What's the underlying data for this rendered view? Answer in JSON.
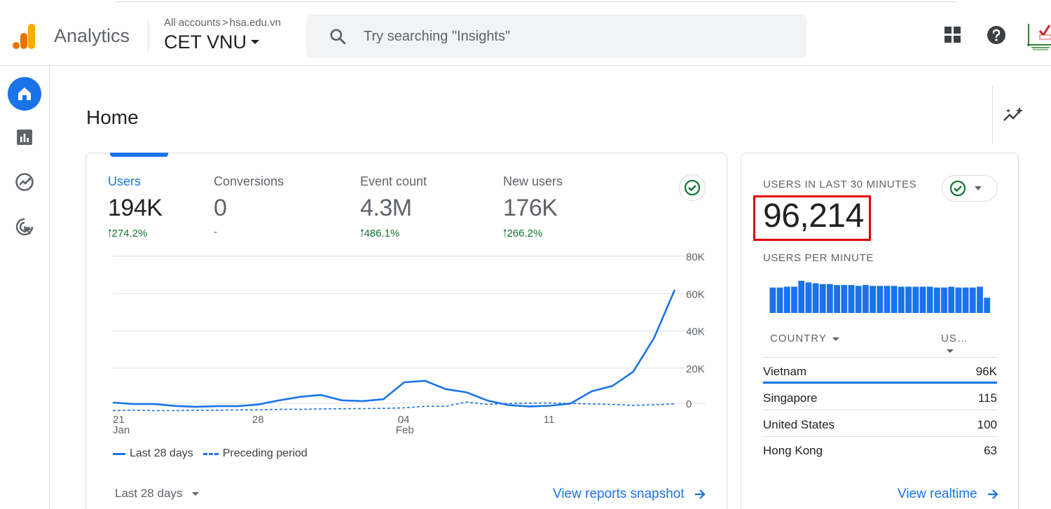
{
  "app": {
    "name": "Analytics"
  },
  "breadcrumb": {
    "account": "All accounts",
    "sub": "hsa.edu.vn"
  },
  "property": {
    "name": "CET VNU"
  },
  "search": {
    "placeholder": "Try searching \"Insights\""
  },
  "page": {
    "title": "Home"
  },
  "metrics": [
    {
      "label": "Users",
      "value": "194K",
      "change": "274.2%"
    },
    {
      "label": "Conversions",
      "value": "0",
      "change": "-"
    },
    {
      "label": "Event count",
      "value": "4.3M",
      "change": "486.1%"
    },
    {
      "label": "New users",
      "value": "176K",
      "change": "266.2%"
    }
  ],
  "chart_data": {
    "type": "line",
    "x_tick_labels": [
      {
        "day": "21",
        "month": "Jan"
      },
      {
        "day": "28",
        "month": ""
      },
      {
        "day": "04",
        "month": "Feb"
      },
      {
        "day": "11",
        "month": ""
      }
    ],
    "y_tick_labels": [
      "80K",
      "60K",
      "40K",
      "20K",
      "0"
    ],
    "ylim": [
      0,
      80000
    ],
    "x": [
      "Jan 21",
      "Jan 22",
      "Jan 23",
      "Jan 24",
      "Jan 25",
      "Jan 26",
      "Jan 27",
      "Jan 28",
      "Jan 29",
      "Jan 30",
      "Jan 31",
      "Feb 1",
      "Feb 2",
      "Feb 3",
      "Feb 4",
      "Feb 5",
      "Feb 6",
      "Feb 7",
      "Feb 8",
      "Feb 9",
      "Feb 10",
      "Feb 11",
      "Feb 12",
      "Feb 13",
      "Feb 14",
      "Feb 15",
      "Feb 16",
      "Feb 17"
    ],
    "series": [
      {
        "name": "Last 28 days",
        "style": "solid",
        "values": [
          1500,
          700,
          700,
          -300,
          -800,
          -400,
          -400,
          500,
          2700,
          4600,
          5600,
          2700,
          2300,
          3300,
          12400,
          13200,
          8700,
          7000,
          2600,
          200,
          -600,
          -200,
          1000,
          7500,
          10400,
          18000,
          36000,
          62000
        ]
      },
      {
        "name": "Preceding period",
        "style": "dashed",
        "values": [
          -2800,
          -2500,
          -2800,
          -2800,
          -2600,
          -2600,
          -2400,
          -2400,
          -2100,
          -2100,
          -1900,
          -1800,
          -1700,
          -1600,
          -1300,
          -500,
          -500,
          1800,
          500,
          1000,
          1200,
          1300,
          1000,
          800,
          500,
          0,
          300,
          800
        ]
      }
    ],
    "grid": true
  },
  "legend": {
    "current": "Last 28 days",
    "previous": "Preceding period"
  },
  "range": {
    "label": "Last 28 days"
  },
  "links": {
    "snapshot": "View reports snapshot",
    "realtime": "View realtime"
  },
  "realtime": {
    "title": "USERS IN LAST 30 MINUTES",
    "value": "96,214",
    "subtitle": "USERS PER MINUTE",
    "per_minute": [
      30,
      30,
      31,
      31,
      38,
      36,
      35,
      34,
      34,
      33,
      33,
      33,
      32,
      33,
      32,
      32,
      32,
      32,
      31,
      31,
      31,
      31,
      31,
      30,
      30,
      31,
      30,
      30,
      30,
      31,
      18
    ],
    "table": {
      "col_country": "COUNTRY",
      "col_users": "US…",
      "rows": [
        {
          "country": "Vietnam",
          "value": "96K"
        },
        {
          "country": "Singapore",
          "value": "115"
        },
        {
          "country": "United States",
          "value": "100"
        },
        {
          "country": "Hong Kong",
          "value": "63"
        }
      ]
    }
  },
  "colors": {
    "accent": "#1a73e8",
    "positive": "#137333",
    "highlight": "#e00000"
  }
}
